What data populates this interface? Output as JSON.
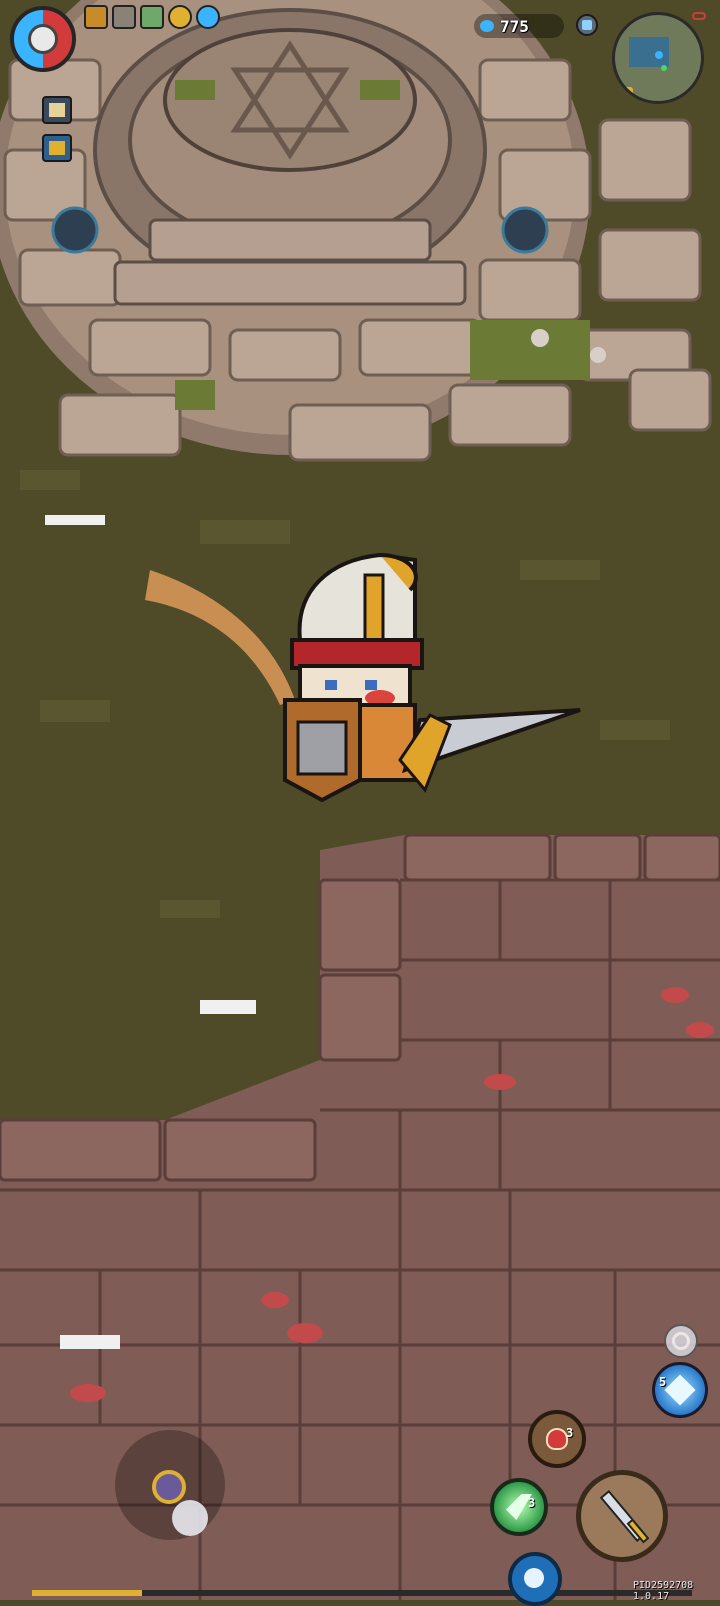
{
  "hud": {
    "gem_count": "775",
    "build_id": "PID2592708 1.0.17"
  },
  "skills": {
    "potion_charges": "3",
    "dash_charges": "3",
    "magic_charges": "5"
  },
  "icons": {
    "settings": "hexagon-gear-icon",
    "status_effects": [
      "torch-buff-icon",
      "helmet-buff-icon",
      "sword-buff-icon",
      "coin-buff-icon",
      "spirit-buff-icon"
    ],
    "quest": "scroll-icon",
    "map_flag": "flag-icon",
    "gem": "gem-icon",
    "pet": "helmet-icon",
    "minimap": "minimap",
    "attack": "sword-icon",
    "potion": "potion-icon",
    "dash": "dash-icon",
    "magic": "magic-bolt-icon",
    "shield_skill": "shield-icon"
  },
  "colors": {
    "grass": "#4f4b28",
    "stone_floor": "#7f5c55",
    "stone_plaza": "#b19a8c",
    "accent_blue": "#3ab4ff",
    "accent_red": "#d33b3b"
  }
}
